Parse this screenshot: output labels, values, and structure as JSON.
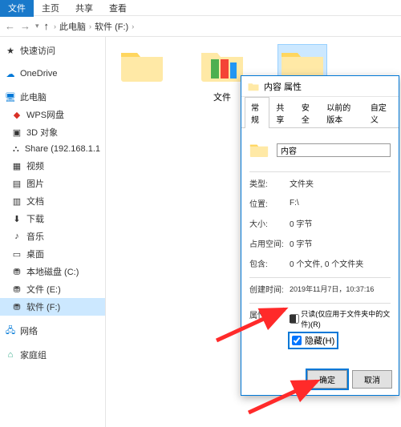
{
  "ribbon": {
    "file": "文件",
    "home": "主页",
    "share": "共享",
    "view": "查看"
  },
  "breadcrumb": {
    "root": "此电脑",
    "drive": "软件 (F:)"
  },
  "sidebar": {
    "quick": "快速访问",
    "onedrive": "OneDrive",
    "thispc": "此电脑",
    "wps": "WPS网盘",
    "obj3d": "3D 对象",
    "share": "Share (192.168.1.1",
    "videos": "视频",
    "pictures": "图片",
    "documents": "文档",
    "downloads": "下载",
    "music": "音乐",
    "desktop": "桌面",
    "localc": "本地磁盘 (C:)",
    "filee": "文件 (E:)",
    "softf": "软件 (F:)",
    "network": "网络",
    "homegroup": "家庭组"
  },
  "folders": {
    "f1": "文件",
    "f2": "内容",
    "f1_sub": ""
  },
  "dialog": {
    "title": "内容 属性",
    "tabs": {
      "general": "常规",
      "share": "共享",
      "security": "安全",
      "prev": "以前的版本",
      "custom": "自定义"
    },
    "name": "内容",
    "type_l": "类型:",
    "type_v": "文件夹",
    "loc_l": "位置:",
    "loc_v": "F:\\",
    "size_l": "大小:",
    "size_v": "0 字节",
    "disk_l": "占用空间:",
    "disk_v": "0 字节",
    "contain_l": "包含:",
    "contain_v": "0 个文件, 0 个文件夹",
    "created_l": "创建时间:",
    "created_v": "2019年11月7日，10:37:16",
    "attr_l": "属性:",
    "readonly": "只读(仅应用于文件夹中的文件)(R)",
    "hidden": "隐藏(H)",
    "ok": "确定",
    "cancel": "取消"
  }
}
